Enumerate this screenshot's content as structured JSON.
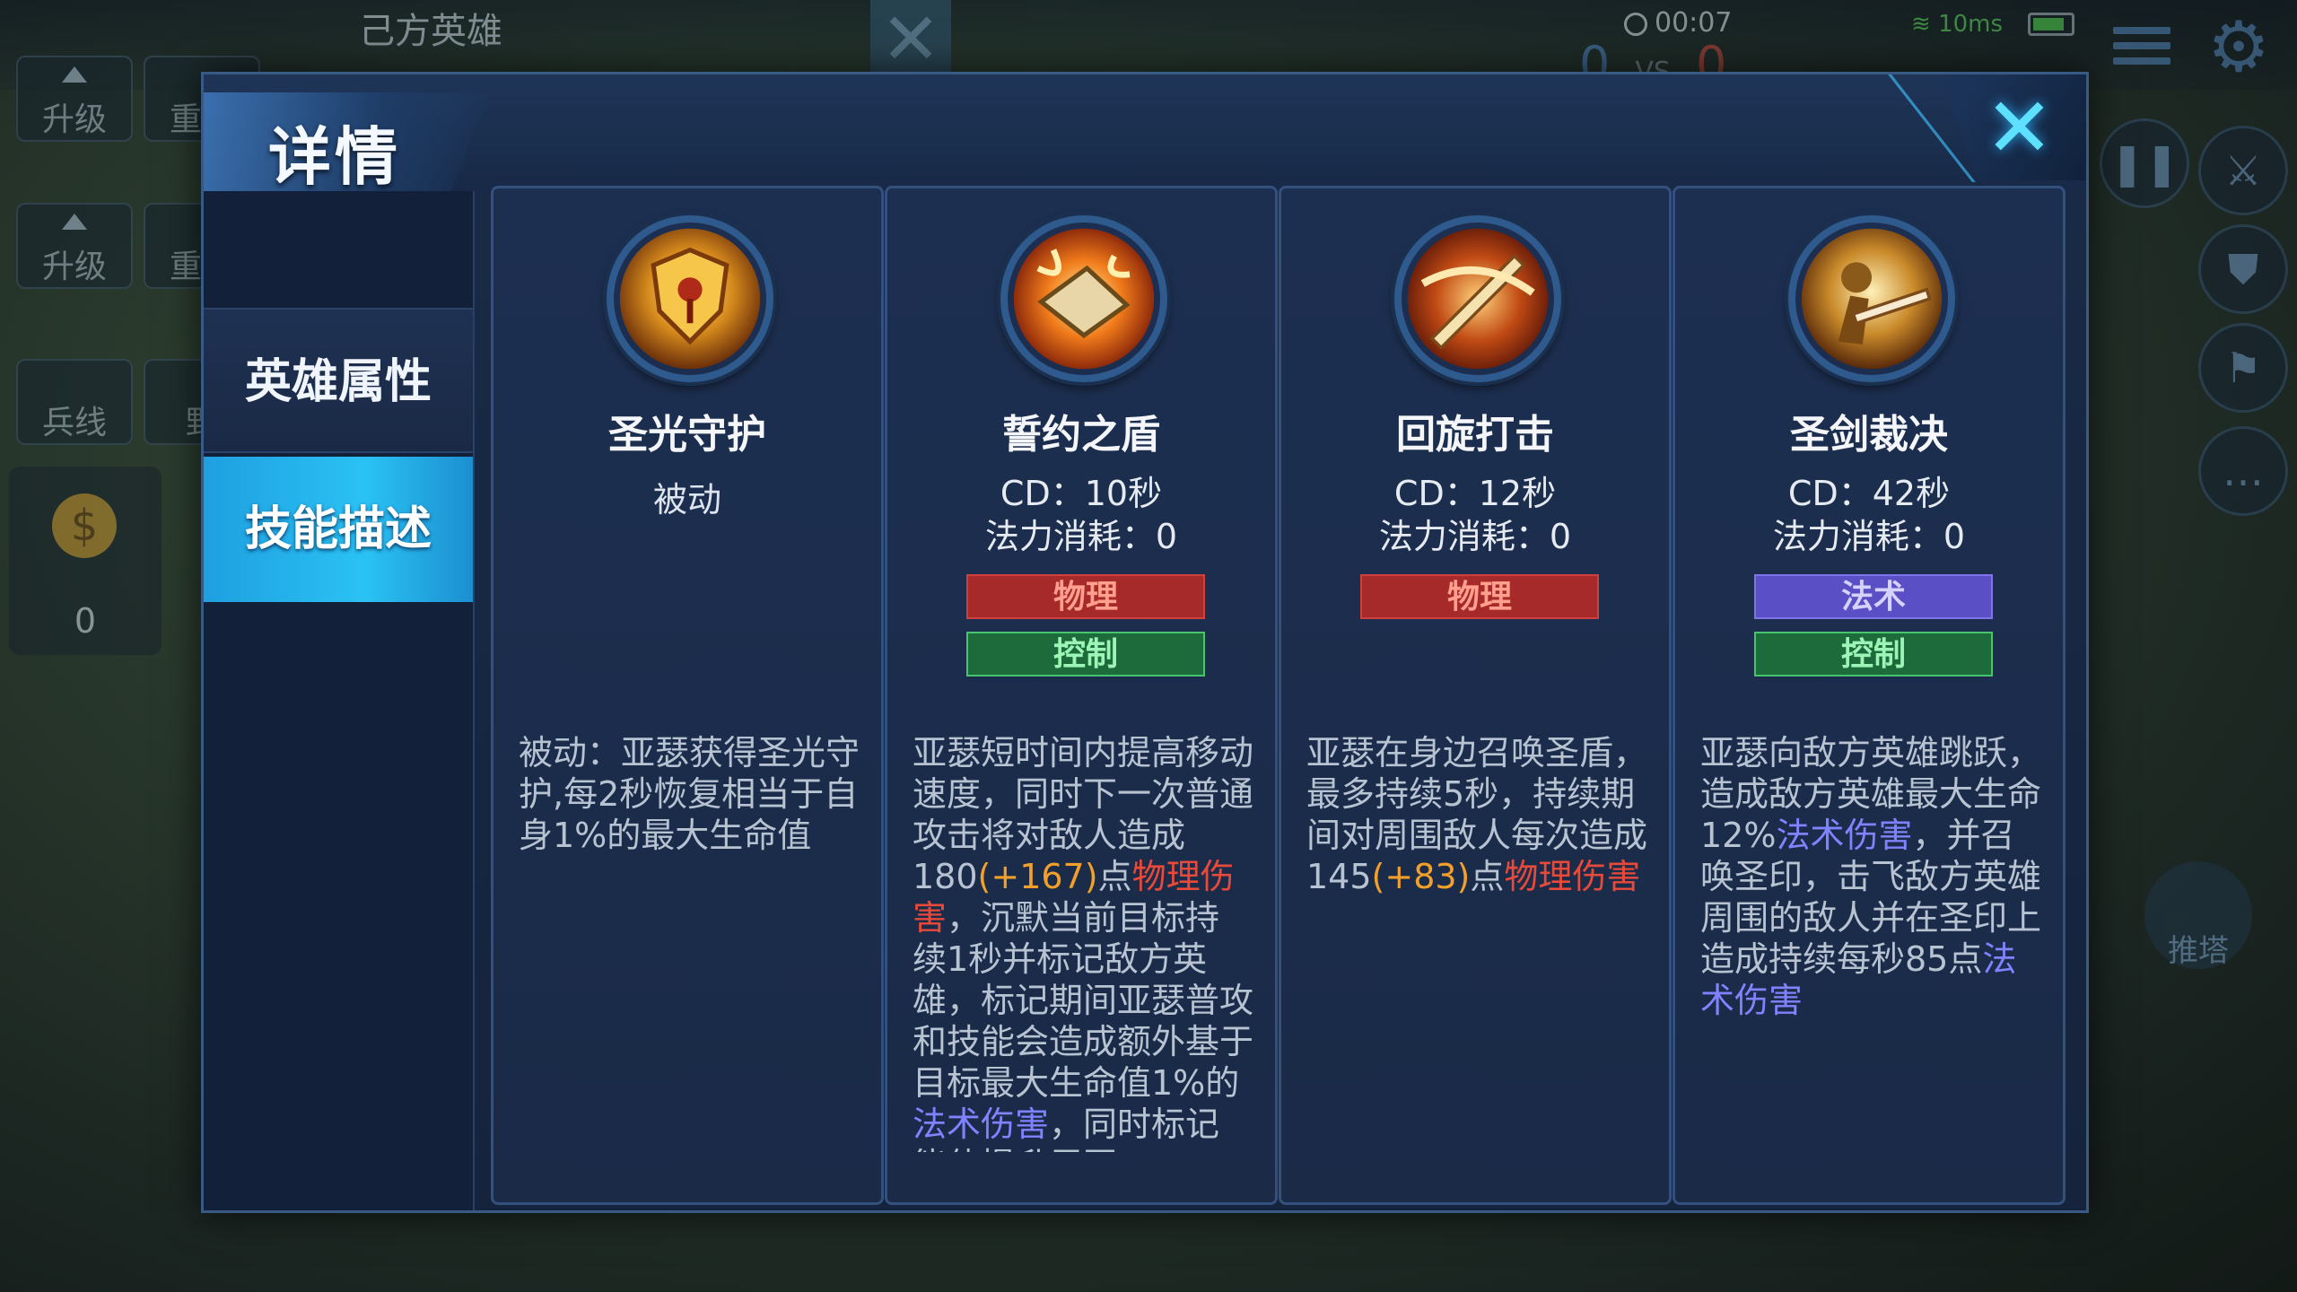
{
  "background_hud": {
    "team_title": "己方英雄",
    "left_buttons": [
      "升级",
      "重置",
      "升级",
      "重置",
      "兵线",
      "野"
    ],
    "timer": "00:07",
    "score_blue": "0",
    "score_vs": "VS",
    "score_red": "0",
    "ping": "10ms",
    "gold": "0",
    "tower_label": "推塔"
  },
  "dialog": {
    "title": "详情",
    "tabs": [
      {
        "label": "英雄属性",
        "active": false
      },
      {
        "label": "技能描述",
        "active": true
      }
    ]
  },
  "skills": [
    {
      "name": "圣光守护",
      "type": "被动",
      "icon": "shield-emblem-icon",
      "desc": "被动：亚瑟获得圣光守护,每2秒恢复相当于自身1%的最大生命值"
    },
    {
      "name": "誓约之盾",
      "cd": "CD：10秒",
      "cost": "法力消耗：0",
      "tag1": "物理",
      "tag2": "控制",
      "icon": "flaming-shield-icon",
      "desc_parts": [
        "亚瑟短时间内提高移动速度，同时下一次普通攻击将对敌人造成180",
        "(+167)",
        "点",
        "物理伤害",
        "，沉默当前目标持续1秒并标记敌方英雄，标记期间亚瑟普攻和技能会造成额外基于目标最大生命值1%的",
        "法术伤害",
        "，同时标记能使提升周围"
      ]
    },
    {
      "name": "回旋打击",
      "cd": "CD：12秒",
      "cost": "法力消耗：0",
      "tag1": "物理",
      "icon": "spinning-sword-icon",
      "desc_parts": [
        "亚瑟在身边召唤圣盾，最多持续5秒，持续期间对周围敌人每次造成145",
        "(+83)",
        "点",
        "物理伤害"
      ]
    },
    {
      "name": "圣剑裁决",
      "cd": "CD：42秒",
      "cost": "法力消耗：0",
      "tag1": "法术",
      "tag2": "控制",
      "icon": "holy-sword-icon",
      "desc_parts": [
        "亚瑟向敌方英雄跳跃，造成敌方英雄最大生命12%",
        "法术伤害",
        "，并召唤圣印，击飞敌方英雄周围的敌人并在圣印上造成持续每秒85点",
        "法术伤害"
      ]
    }
  ],
  "colors": {
    "physical": "#a72a2a",
    "magic": "#5a4fc4",
    "control": "#1d6a3a",
    "accent": "#2ac2f4",
    "bonus": "#f2a02a",
    "physical_text": "#e84a3a",
    "magic_text": "#7f83ff"
  }
}
